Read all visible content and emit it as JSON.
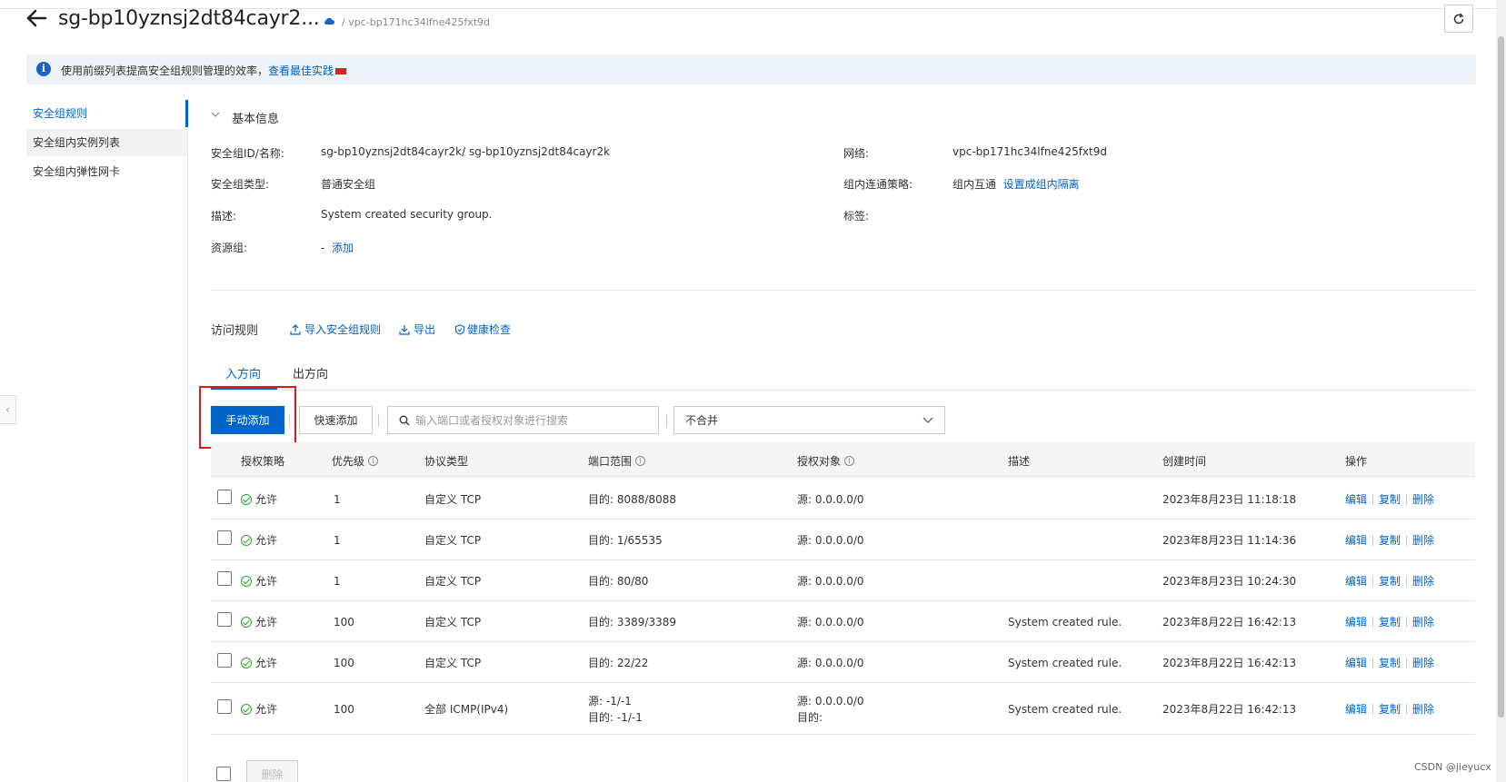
{
  "header": {
    "title": "sg-bp10yznsj2dt84cayr2...",
    "vpc_crumb": "/ vpc-bp171hc34lfne425fxt9d",
    "refresh_label": "C"
  },
  "notice": {
    "text": "使用前缀列表提高安全组规则管理的效率，",
    "link": "查看最佳实践"
  },
  "sidebar": {
    "items": [
      {
        "label": "安全组规则"
      },
      {
        "label": "安全组内实例列表"
      },
      {
        "label": "安全组内弹性网卡"
      }
    ]
  },
  "basic_info": {
    "section_title": "基本信息",
    "id_name_label": "安全组ID/名称:",
    "id_name_value": "sg-bp10yznsj2dt84cayr2k/ sg-bp10yznsj2dt84cayr2k",
    "type_label": "安全组类型:",
    "type_value": "普通安全组",
    "desc_label": "描述:",
    "desc_value": "System created security group.",
    "resource_group_label": "资源组:",
    "resource_group_value": "-",
    "resource_group_add": "添加",
    "network_label": "网络:",
    "network_value": "vpc-bp171hc34lfne425fxt9d",
    "policy_label": "组内连通策略:",
    "policy_value": "组内互通",
    "policy_link": "设置成组内隔离",
    "tags_label": "标签:"
  },
  "rules": {
    "title": "访问规则",
    "import_label": "导入安全组规则",
    "export_label": "导出",
    "health_label": "健康检查",
    "tabs": [
      {
        "label": "入方向"
      },
      {
        "label": "出方向"
      }
    ],
    "manual_add": "手动添加",
    "quick_add": "快速添加",
    "search_placeholder": "输入端口或者授权对象进行搜索",
    "merge_select": "不合并",
    "columns": [
      "授权策略",
      "优先级",
      "协议类型",
      "端口范围",
      "授权对象",
      "描述",
      "创建时间",
      "操作"
    ],
    "rows": [
      {
        "policy": "允许",
        "priority": "1",
        "protocol": "自定义 TCP",
        "port": "目的: 8088/8088",
        "port2": "",
        "auth": "源: 0.0.0.0/0",
        "auth2": "",
        "desc": "",
        "created": "2023年8月23日 11:18:18"
      },
      {
        "policy": "允许",
        "priority": "1",
        "protocol": "自定义 TCP",
        "port": "目的: 1/65535",
        "port2": "",
        "auth": "源: 0.0.0.0/0",
        "auth2": "",
        "desc": "",
        "created": "2023年8月23日 11:14:36"
      },
      {
        "policy": "允许",
        "priority": "1",
        "protocol": "自定义 TCP",
        "port": "目的: 80/80",
        "port2": "",
        "auth": "源: 0.0.0.0/0",
        "auth2": "",
        "desc": "",
        "created": "2023年8月23日 10:24:30"
      },
      {
        "policy": "允许",
        "priority": "100",
        "protocol": "自定义 TCP",
        "port": "目的: 3389/3389",
        "port2": "",
        "auth": "源: 0.0.0.0/0",
        "auth2": "",
        "desc": "System created rule.",
        "created": "2023年8月22日 16:42:13"
      },
      {
        "policy": "允许",
        "priority": "100",
        "protocol": "自定义 TCP",
        "port": "目的: 22/22",
        "port2": "",
        "auth": "源: 0.0.0.0/0",
        "auth2": "",
        "desc": "System created rule.",
        "created": "2023年8月22日 16:42:13"
      },
      {
        "policy": "允许",
        "priority": "100",
        "protocol": "全部 ICMP(IPv4)",
        "port": "源: -1/-1",
        "port2": "目的: -1/-1",
        "auth": "源: 0.0.0.0/0",
        "auth2": "目的:",
        "desc": "System created rule.",
        "created": "2023年8月22日 16:42:13"
      }
    ],
    "op_edit": "编辑",
    "op_copy": "复制",
    "op_delete": "删除",
    "bulk_delete": "删除"
  },
  "watermark": "CSDN @jieyucx",
  "colors": {
    "accent": "#0064c8",
    "highlight_box": "#e6161f",
    "allow_green": "#2ba62b"
  }
}
